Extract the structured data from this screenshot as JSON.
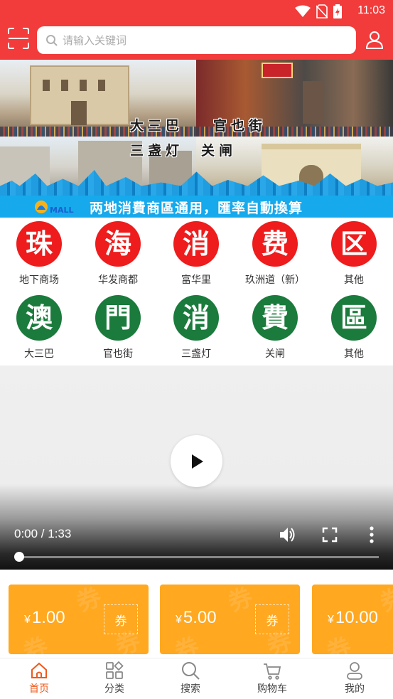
{
  "status_bar": {
    "time": "11:03",
    "icons": [
      "wifi-icon",
      "no-sim-icon",
      "battery-charging-icon"
    ]
  },
  "header": {
    "search_placeholder": "请输入关键词",
    "icons": [
      "scan-icon",
      "search-icon",
      "user-icon"
    ]
  },
  "banner": {
    "captions": [
      "大三巴",
      "官也街",
      "三盏灯",
      "关闸"
    ],
    "logo_text": "MALL",
    "slogan": "两地消費商區通用，匯率自動換算"
  },
  "categories": {
    "row1": [
      {
        "char": "珠",
        "label": "地下商场",
        "color": "#ee1c1c"
      },
      {
        "char": "海",
        "label": "华发商都",
        "color": "#ee1c1c"
      },
      {
        "char": "消",
        "label": "富华里",
        "color": "#ee1c1c"
      },
      {
        "char": "费",
        "label": "玖洲道（新）",
        "color": "#ee1c1c"
      },
      {
        "char": "区",
        "label": "其他",
        "color": "#ee1c1c"
      }
    ],
    "row2": [
      {
        "char": "澳",
        "label": "大三巴",
        "color": "#1a7b3c"
      },
      {
        "char": "門",
        "label": "官也街",
        "color": "#1a7b3c"
      },
      {
        "char": "消",
        "label": "三盏灯",
        "color": "#1a7b3c"
      },
      {
        "char": "費",
        "label": "关闸",
        "color": "#1a7b3c"
      },
      {
        "char": "區",
        "label": "其他",
        "color": "#1a7b3c"
      }
    ]
  },
  "video": {
    "time_display": "0:00 / 1:33",
    "progress": 0,
    "icons": [
      "play-icon",
      "volume-icon",
      "fullscreen-icon",
      "more-vertical-icon"
    ]
  },
  "coupons": [
    {
      "currency": "¥",
      "amount": "1.00",
      "tag": "券"
    },
    {
      "currency": "¥",
      "amount": "5.00",
      "tag": "券"
    },
    {
      "currency": "¥",
      "amount": "10.00",
      "tag": "券"
    }
  ],
  "tabbar": {
    "active_color": "#f05a1a",
    "tabs": [
      {
        "label": "首页",
        "icon": "home-icon",
        "active": true
      },
      {
        "label": "分类",
        "icon": "category-icon",
        "active": false
      },
      {
        "label": "搜索",
        "icon": "search-icon",
        "active": false
      },
      {
        "label": "购物车",
        "icon": "cart-icon",
        "active": false
      },
      {
        "label": "我的",
        "icon": "profile-icon",
        "active": false
      }
    ]
  }
}
